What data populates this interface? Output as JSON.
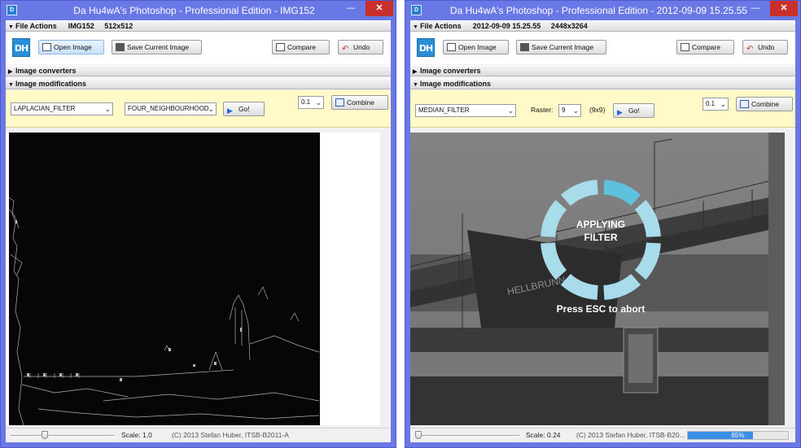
{
  "left": {
    "title": "Da Hu4wA's Photoshop - Professional Edition  - IMG152",
    "file_actions": {
      "label": "File Actions",
      "meta": "IMG152     512x512"
    },
    "logo": "DH",
    "buttons": {
      "open": "Open Image",
      "save": "Save Current Image",
      "compare": "Compare",
      "undo": "Undo"
    },
    "converters_label": "Image converters",
    "modifications_label": "Image modifications",
    "filter": "LAPLACIAN_FILTER",
    "neighbourhood": "FOUR_NEIGHBOURHOOD",
    "go": "Go!",
    "amount": "0.1",
    "combine": "Combine",
    "scale": "Scale: 1.0",
    "copyright": "(C) 2013 Stefan Huber, ITSB-B2011-A"
  },
  "right": {
    "title": "Da Hu4wA's Photoshop - Professional Edition  - 2012-09-09 15.25.55",
    "file_actions": {
      "label": "File Actions",
      "meta": "2012-09-09 15.25.55     2448x3264"
    },
    "logo": "DH",
    "buttons": {
      "open": "Open Image",
      "save": "Save Current Image",
      "compare": "Compare",
      "undo": "Undo"
    },
    "converters_label": "Image converters",
    "modifications_label": "Image modifications",
    "filter": "MEDIAN_FILTER",
    "raster_label": "Raster:",
    "raster_value": "9",
    "raster_size": "(9x9)",
    "go": "Go!",
    "amount": "0.1",
    "combine": "Combine",
    "busy_line1": "APPLYING",
    "busy_line2": "FILTER",
    "abort_hint": "Press ESC to abort",
    "scale": "Scale: 0.24",
    "copyright": "(C) 2013 Stefan Huber, ITSB-B20...",
    "progress_text": "65%",
    "progress": 0.65
  },
  "window_controls": {
    "minimize": "—",
    "close": "✕"
  },
  "colors": {
    "titlebar": "#6a78e6",
    "close": "#c8302c",
    "mod_panel": "#fffac8",
    "spinner": "#a8dcea",
    "spinner_active": "#5fc1dc",
    "progress": "#3a8ee6"
  },
  "icons": [
    "app-icon",
    "open-folder-icon",
    "save-icon",
    "compare-icon",
    "undo-icon",
    "go-icon",
    "combine-icon",
    "chevron-down-icon",
    "spinner-icon"
  ]
}
